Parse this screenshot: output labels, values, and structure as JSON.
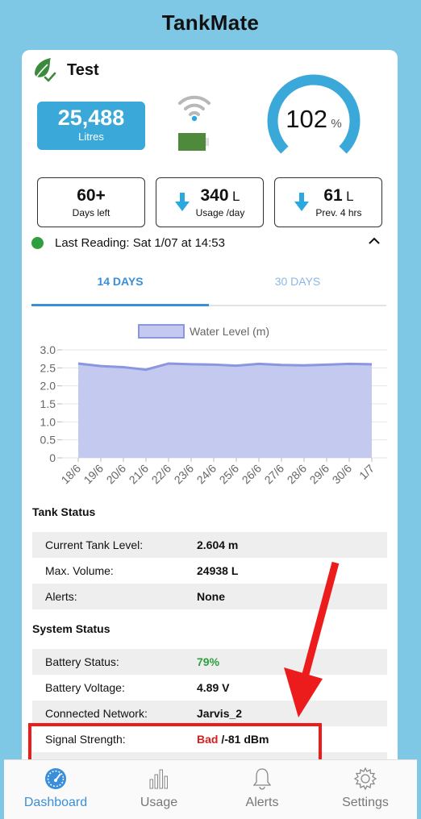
{
  "app": {
    "title": "TankMate"
  },
  "tank": {
    "name": "Test",
    "volume_value": "25,488",
    "volume_unit": "Litres",
    "level_value": "102",
    "level_unit": "%",
    "level_fraction": 1.0
  },
  "stats": [
    {
      "value": "60+",
      "unit": "",
      "label": "Days left",
      "icon": ""
    },
    {
      "value": "340",
      "unit": "L",
      "label": "Usage /day",
      "icon": "arrow-down-icon"
    },
    {
      "value": "61",
      "unit": "L",
      "label": "Prev. 4 hrs",
      "icon": "arrow-down-icon"
    }
  ],
  "last_reading": "Last Reading: Sat 1/07 at 14:53",
  "tabs": [
    {
      "label": "14 DAYS",
      "active": true
    },
    {
      "label": "30 DAYS",
      "active": false
    }
  ],
  "chart_data": {
    "type": "area",
    "legend": "Water Level (m)",
    "legend_placement": "top-center",
    "x": [
      "18/6",
      "19/6",
      "20/6",
      "21/6",
      "22/6",
      "23/6",
      "24/6",
      "25/6",
      "26/6",
      "27/6",
      "28/6",
      "29/6",
      "30/6",
      "1/7"
    ],
    "values": [
      2.62,
      2.55,
      2.52,
      2.45,
      2.62,
      2.6,
      2.59,
      2.56,
      2.61,
      2.58,
      2.57,
      2.59,
      2.61,
      2.6
    ],
    "yticks": [
      "3.0",
      "2.5",
      "2.0",
      "1.5",
      "1.0",
      "0.5",
      "0"
    ],
    "ylim": [
      0,
      3.0
    ],
    "grid": true,
    "fill_color": "#c4c9ef",
    "line_color": "#8b95e0"
  },
  "tank_status": {
    "title": "Tank Status",
    "rows": [
      {
        "label": "Current Tank Level:",
        "value": "2.604 m"
      },
      {
        "label": "Max. Volume:",
        "value": "24938 L"
      },
      {
        "label": "Alerts:",
        "value": "None"
      }
    ]
  },
  "system_status": {
    "title": "System Status",
    "rows": [
      {
        "label": "Battery Status:",
        "value": "79%"
      },
      {
        "label": "Battery Voltage:",
        "value": "4.89 V"
      },
      {
        "label": "Connected Network:",
        "value": "Jarvis_2"
      },
      {
        "label": "Signal Strength:",
        "value_bad": "Bad",
        "value": "/-81 dBm"
      }
    ]
  },
  "nav": [
    {
      "label": "Dashboard",
      "icon": "dashboard-icon",
      "active": true
    },
    {
      "label": "Usage",
      "icon": "bar-chart-icon",
      "active": false
    },
    {
      "label": "Alerts",
      "icon": "bell-icon",
      "active": false
    },
    {
      "label": "Settings",
      "icon": "gear-icon",
      "active": false
    }
  ],
  "colors": {
    "background": "#7ec8e6",
    "accent": "#3aa8d8",
    "tab_active": "#3a8fd8",
    "good": "#2e9e3e",
    "bad": "#d42020",
    "annotation": "#ec1c1c"
  }
}
